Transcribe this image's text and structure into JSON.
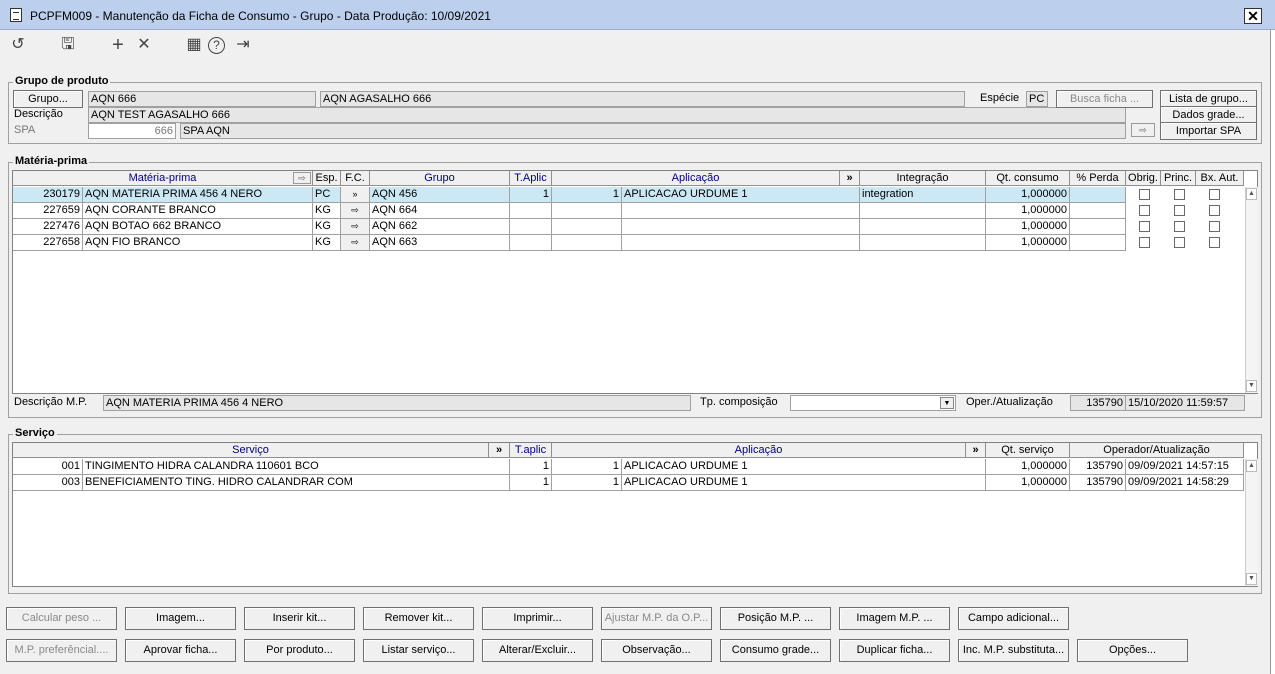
{
  "window": {
    "title": "PCPFM009 - Manutenção da Ficha de Consumo - Grupo - Data Produção: 10/09/2021",
    "close": "✕"
  },
  "toolbar": {
    "undo": "↺",
    "save": "🖫",
    "add": "+",
    "remove": "✕",
    "calendar": "▦",
    "help": "?",
    "exit": "⇥"
  },
  "grupo": {
    "legend": "Grupo de produto",
    "grupo_btn": "Grupo...",
    "grupo_code": "AQN 666",
    "grupo_name": "AQN AGASALHO 666",
    "descricao_label": "Descrição",
    "descricao": "AQN TEST AGASALHO 666",
    "spa_label": "SPA",
    "spa_code": "666",
    "spa_name": "SPA AQN",
    "especie_label": "Espécie",
    "especie": "PC",
    "busca_btn": "Busca ficha ...",
    "lista_btn": "Lista de grupo...",
    "dados_btn": "Dados grade...",
    "importar_btn": "Importar SPA"
  },
  "mp": {
    "legend": "Matéria-prima",
    "headers": [
      "Matéria-prima",
      "Esp.",
      "F.C.",
      "Grupo",
      "T.Aplic",
      "Aplicação",
      "»",
      "Integração",
      "Qt. consumo",
      "% Perda",
      "Obrig.",
      "Princ.",
      "Bx. Aut."
    ],
    "rows": [
      {
        "code": "230179",
        "name": "AQN MATERIA PRIMA 456 4 NERO",
        "esp": "PC",
        "grupo": "AQN 456",
        "taplic": "1",
        "aplic_code": "1",
        "aplicacao": "APLICACAO URDUME 1",
        "integracao": "integration",
        "qt": "1,000000",
        "perda": ""
      },
      {
        "code": "227659",
        "name": "AQN CORANTE BRANCO",
        "esp": "KG",
        "grupo": "AQN 664",
        "taplic": "",
        "aplic_code": "",
        "aplicacao": "",
        "integracao": "",
        "qt": "1,000000",
        "perda": ""
      },
      {
        "code": "227476",
        "name": "AQN BOTAO 662 BRANCO",
        "esp": "KG",
        "grupo": "AQN 662",
        "taplic": "",
        "aplic_code": "",
        "aplicacao": "",
        "integracao": "",
        "qt": "1,000000",
        "perda": ""
      },
      {
        "code": "227658",
        "name": "AQN FIO BRANCO",
        "esp": "KG",
        "grupo": "AQN 663",
        "taplic": "",
        "aplic_code": "",
        "aplicacao": "",
        "integracao": "",
        "qt": "1,000000",
        "perda": ""
      }
    ],
    "desc_label": "Descrição M.P.",
    "desc_value": "AQN MATERIA PRIMA 456 4 NERO",
    "tp_label": "Tp. composição",
    "oper_label": "Oper./Atualização",
    "oper_user": "135790",
    "oper_date": "15/10/2020 11:59:57"
  },
  "servico": {
    "legend": "Serviço",
    "headers": [
      "Serviço",
      "»",
      "T.aplic",
      "Aplicação",
      "»",
      "Qt. serviço",
      "Operador/Atualização"
    ],
    "rows": [
      {
        "code": "001",
        "name": "TINGIMENTO HIDRA CALANDRA 110601 BCO",
        "taplic": "1",
        "aplic_code": "1",
        "aplicacao": "APLICACAO URDUME 1",
        "qt": "1,000000",
        "user": "135790",
        "date": "09/09/2021 14:57:15"
      },
      {
        "code": "003",
        "name": "BENEFICIAMENTO TING. HIDRO CALANDRAR COM",
        "taplic": "1",
        "aplic_code": "1",
        "aplicacao": "APLICACAO URDUME 1",
        "qt": "1,000000",
        "user": "135790",
        "date": "09/09/2021 14:58:29"
      }
    ]
  },
  "buttons": {
    "row1": [
      "Calcular peso ...",
      "Imagem...",
      "Inserir kit...",
      "Remover kit...",
      "Imprimir...",
      "Ajustar M.P. da O.P...",
      "Posição M.P. ...",
      "Imagem M.P. ...",
      "Campo adicional..."
    ],
    "row2": [
      "M.P. preferêncial....",
      "Aprovar ficha...",
      "Por produto...",
      "Listar serviço...",
      "Alterar/Excluir...",
      "Observação...",
      "Consumo grade...",
      "Duplicar ficha...",
      "Inc. M.P. substituta...",
      "Opções..."
    ]
  }
}
